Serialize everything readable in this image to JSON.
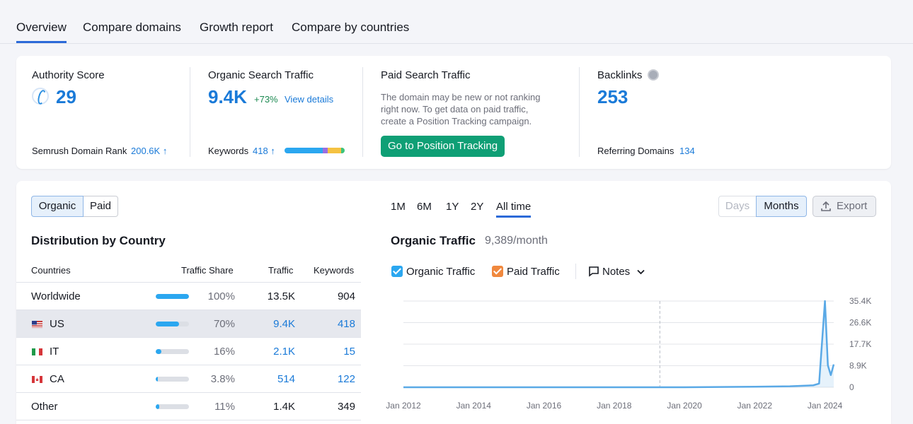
{
  "tabs": [
    "Overview",
    "Compare domains",
    "Growth report",
    "Compare by countries"
  ],
  "authority": {
    "label": "Authority Score",
    "value": "29",
    "rank_label": "Semrush Domain Rank",
    "rank_value": "200.6K ↑"
  },
  "organic": {
    "label": "Organic Search Traffic",
    "value": "9.4K",
    "change": "+73%",
    "link": "View details",
    "kw_label": "Keywords",
    "kw_value": "418 ↑"
  },
  "paid": {
    "label": "Paid Search Traffic",
    "desc1": "The domain may be new or not ranking",
    "desc2": "right now. To get data on paid traffic,",
    "desc3": "create a Position Tracking campaign.",
    "button": "Go to Position Tracking"
  },
  "backlinks": {
    "label": "Backlinks",
    "value": "253",
    "ref_label": "Referring Domains",
    "ref_value": "134"
  },
  "toggle": {
    "organic": "Organic",
    "paid": "Paid"
  },
  "ranges": [
    "1M",
    "6M",
    "1Y",
    "2Y",
    "All time"
  ],
  "view": {
    "days": "Days",
    "months": "Months",
    "export": "Export"
  },
  "distribution": {
    "title": "Distribution by Country",
    "headers": [
      "Countries",
      "Traffic Share",
      "Traffic",
      "Keywords"
    ],
    "rows": [
      {
        "country": "Worldwide",
        "share": "100%",
        "share_frac": 1.0,
        "traffic": "13.5K",
        "keywords": "904"
      },
      {
        "country": "US",
        "share": "70%",
        "share_frac": 0.7,
        "traffic": "9.4K",
        "keywords": "418"
      },
      {
        "country": "IT",
        "share": "16%",
        "share_frac": 0.16,
        "traffic": "2.1K",
        "keywords": "15"
      },
      {
        "country": "CA",
        "share": "3.8%",
        "share_frac": 0.038,
        "traffic": "514",
        "keywords": "122"
      },
      {
        "country": "Other",
        "share": "11%",
        "share_frac": 0.11,
        "traffic": "1.4K",
        "keywords": "349"
      }
    ]
  },
  "traffic_chart": {
    "title": "Organic Traffic",
    "subtitle": "9,389/month",
    "legend": [
      "Organic Traffic",
      "Paid Traffic"
    ],
    "notes": "Notes",
    "colors": {
      "organic": "#5aa9e6",
      "paid": "#f0883e",
      "accent": "#1a7ad8",
      "button": "#0f9f75"
    }
  },
  "chart_data": {
    "type": "line",
    "x": [
      "2012-01",
      "2013-01",
      "2014-01",
      "2015-01",
      "2016-01",
      "2017-01",
      "2018-01",
      "2019-01",
      "2020-01",
      "2021-01",
      "2022-01",
      "2023-01",
      "2023-09",
      "2023-11",
      "2024-01",
      "2024-02",
      "2024-03",
      "2024-04"
    ],
    "series": [
      {
        "name": "Organic Traffic",
        "values": [
          0,
          0,
          0,
          0,
          0,
          0,
          0,
          0,
          0,
          100,
          200,
          400,
          800,
          1500,
          35400,
          9000,
          5000,
          9389
        ]
      }
    ],
    "xticks": [
      "Jan 2012",
      "Jan 2014",
      "Jan 2016",
      "Jan 2018",
      "Jan 2020",
      "Jan 2022",
      "Jan 2024"
    ],
    "yticks": [
      "35.4K",
      "26.6K",
      "17.7K",
      "8.9K",
      "0"
    ],
    "ylim": [
      0,
      35400
    ],
    "grid": true
  }
}
